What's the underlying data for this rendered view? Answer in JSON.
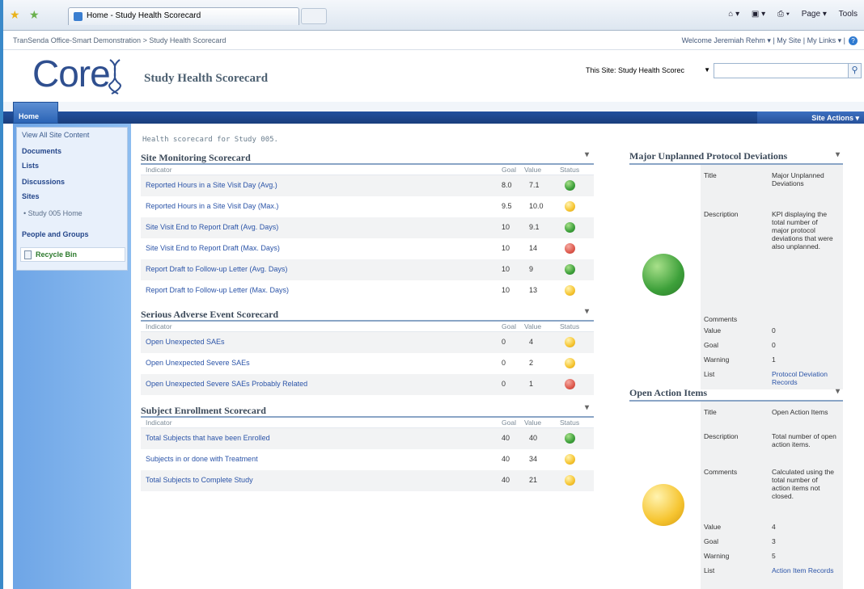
{
  "browser": {
    "tab_title": "Home - Study Health Scorecard",
    "commands": [
      "Page ▾",
      "Tools"
    ]
  },
  "topbar": {
    "breadcrumb": "TranSenda Office-Smart Demonstration > Study Health Scorecard",
    "welcome": "Welcome Jeremiah Rehm ▾  |  My Site  |  My Links ▾  |"
  },
  "header": {
    "logo": "Core",
    "site_title": "Study Health Scorecard",
    "search_scope": "This Site: Study Health Scorec",
    "search_value": ""
  },
  "nav": {
    "home": "Home",
    "site_actions": "Site Actions ▾"
  },
  "leftnav": {
    "view_all": "View All Site Content",
    "documents": "Documents",
    "lists": "Lists",
    "discussions": "Discussions",
    "sites": "Sites",
    "site_item": "• Study 005 Home",
    "people": "People and Groups",
    "recycle": "Recycle Bin"
  },
  "main": {
    "intro": "Health scorecard for Study 005.",
    "headers": {
      "indicator": "Indicator",
      "goal": "Goal",
      "value": "Value",
      "status": "Status"
    },
    "scorecards": [
      {
        "title": "Site Monitoring Scorecard",
        "rows": [
          {
            "indicator": "Reported Hours in a Site Visit Day (Avg.)",
            "goal": "8.0",
            "value": "7.1",
            "status": "green"
          },
          {
            "indicator": "Reported Hours in a Site Visit Day (Max.)",
            "goal": "9.5",
            "value": "10.0",
            "status": "yellow"
          },
          {
            "indicator": "Site Visit End to Report Draft (Avg. Days)",
            "goal": "10",
            "value": "9.1",
            "status": "green"
          },
          {
            "indicator": "Site Visit End to Report Draft (Max. Days)",
            "goal": "10",
            "value": "14",
            "status": "red"
          },
          {
            "indicator": "Report Draft to Follow-up Letter (Avg. Days)",
            "goal": "10",
            "value": "9",
            "status": "green"
          },
          {
            "indicator": "Report Draft to Follow-up Letter (Max. Days)",
            "goal": "10",
            "value": "13",
            "status": "yellow"
          }
        ]
      },
      {
        "title": "Serious Adverse Event Scorecard",
        "rows": [
          {
            "indicator": "Open Unexpected SAEs",
            "goal": "0",
            "value": "4",
            "status": "yellow"
          },
          {
            "indicator": "Open Unexpected Severe SAEs",
            "goal": "0",
            "value": "2",
            "status": "yellow"
          },
          {
            "indicator": "Open Unexpected Severe SAEs Probably Related",
            "goal": "0",
            "value": "1",
            "status": "red"
          }
        ]
      },
      {
        "title": "Subject Enrollment Scorecard",
        "rows": [
          {
            "indicator": "Total Subjects that have been Enrolled",
            "goal": "40",
            "value": "40",
            "status": "green"
          },
          {
            "indicator": "Subjects in or done with Treatment",
            "goal": "40",
            "value": "34",
            "status": "yellow"
          },
          {
            "indicator": "Total Subjects to Complete Study",
            "goal": "40",
            "value": "21",
            "status": "yellow"
          }
        ]
      }
    ]
  },
  "kpis": [
    {
      "title": "Major Unplanned Protocol Deviations",
      "status": "green",
      "fields": {
        "Title": "Major Unplanned Deviations",
        "Description": "KPI displaying the total number of major protocol deviations that were also unplanned.",
        "Comments": "",
        "Value": "0",
        "Goal": "0",
        "Warning": "1",
        "List": "Protocol Deviation Records"
      }
    },
    {
      "title": "Open Action Items",
      "status": "yellow",
      "fields": {
        "Title": "Open Action Items",
        "Description": "Total number of open action items.",
        "Comments": "Calculated using the total number of action items not closed.",
        "Value": "4",
        "Goal": "3",
        "Warning": "5",
        "List": "Action Item Records"
      }
    }
  ],
  "colors": {
    "accent": "#21509d",
    "link": "#2b54a8",
    "green": "#3da03a",
    "yellow": "#f6c531",
    "red": "#de5a4e"
  },
  "icons": [
    "favorites-star-icon",
    "add-favorites-icon",
    "home-icon",
    "feeds-icon",
    "print-icon",
    "page-icon",
    "tools-icon",
    "help-icon",
    "search-icon",
    "recycle-bin-icon",
    "menu-arrow-icon"
  ]
}
